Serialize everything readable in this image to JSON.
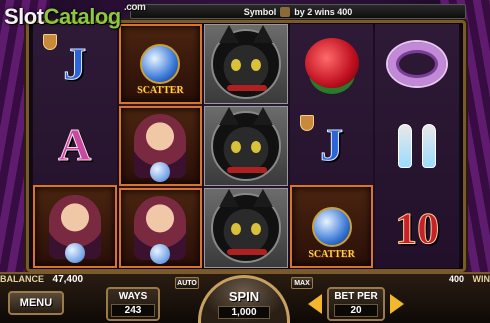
{
  "brand": {
    "part1": "Slot",
    "part2": "Catalog",
    "domain": ".com"
  },
  "topbar": {
    "prefix": "Symbol",
    "suffix": "by 2 wins 400"
  },
  "reels": [
    [
      {
        "symbol": "J",
        "name": "jack"
      },
      {
        "symbol": "A",
        "name": "ace"
      },
      {
        "symbol": "fortune-teller",
        "highlight": true
      }
    ],
    [
      {
        "symbol": "crystal-ball",
        "label": "SCATTER",
        "highlight": true
      },
      {
        "symbol": "fortune-teller",
        "highlight": true
      },
      {
        "symbol": "fortune-teller",
        "highlight": true
      }
    ],
    [
      {
        "symbol": "black-cat"
      },
      {
        "symbol": "black-cat"
      },
      {
        "symbol": "black-cat"
      }
    ],
    [
      {
        "symbol": "rose"
      },
      {
        "symbol": "J",
        "name": "jack"
      },
      {
        "symbol": "crystal-ball",
        "label": "SCATTER",
        "highlight": true
      }
    ],
    [
      {
        "symbol": "bracelet"
      },
      {
        "symbol": "earrings"
      },
      {
        "symbol": "10",
        "name": "ten"
      }
    ]
  ],
  "status": {
    "balance_label": "BALANCE",
    "balance_value": "47,400",
    "win_value": "400",
    "win_label": "WIN"
  },
  "controls": {
    "menu": "MENU",
    "ways_label": "WAYS",
    "ways_value": "243",
    "auto": "AUTO",
    "max": "MAX",
    "spin_label": "SPIN",
    "spin_value": "1,000",
    "betper_label": "BET PER",
    "betper_value": "20"
  },
  "colors": {
    "accent": "#f2b72a",
    "frame": "#7a5a2a",
    "highlight": "#d9742a"
  }
}
